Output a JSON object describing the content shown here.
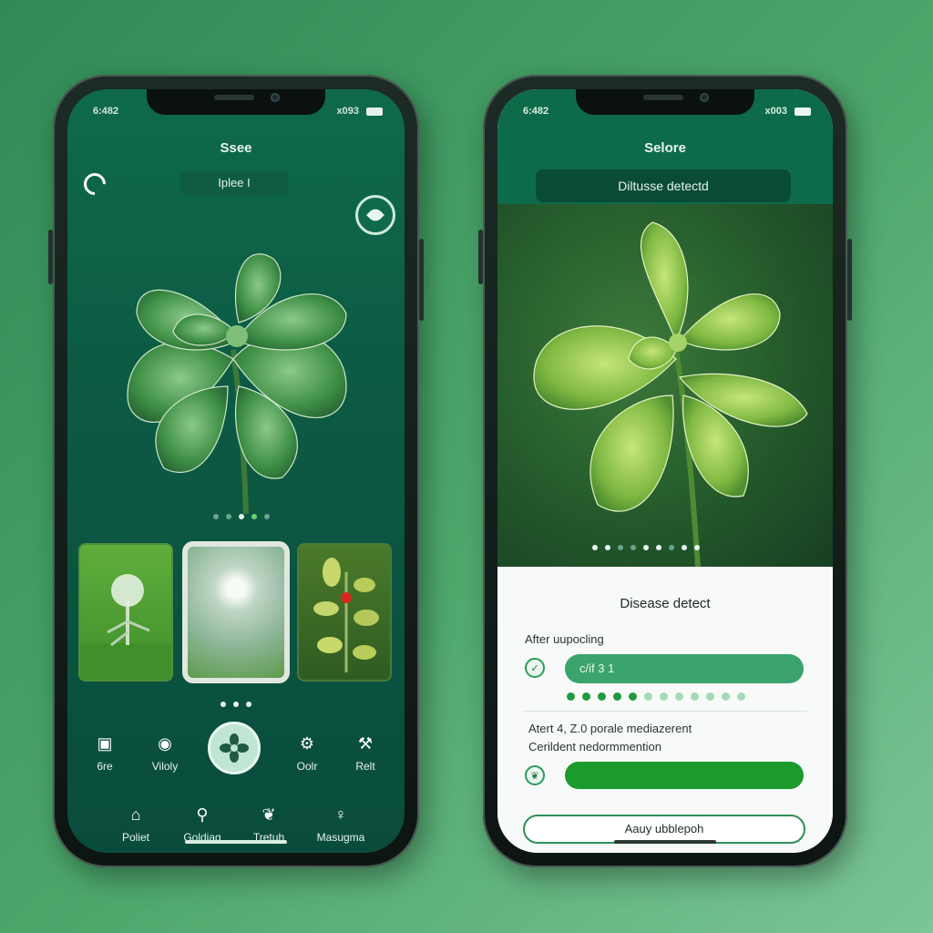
{
  "left_phone": {
    "status_left": "6:482",
    "status_right": "x093",
    "title": "Ssee",
    "search_text": "Iplee I",
    "nav_top": [
      {
        "label": "6re",
        "icon": "camera-icon"
      },
      {
        "label": "Viloly",
        "icon": "location-icon"
      },
      {
        "label": "Oolr",
        "icon": "settings-icon"
      },
      {
        "label": "Relt",
        "icon": "tools-icon"
      }
    ],
    "nav_bottom": [
      {
        "label": "Poliet",
        "icon": "home-icon"
      },
      {
        "label": "Goldiag",
        "icon": "search-icon"
      },
      {
        "label": "Tretuh",
        "icon": "leaf-icon"
      },
      {
        "label": "Masugma",
        "icon": "profile-icon"
      }
    ]
  },
  "right_phone": {
    "status_left": "6:482",
    "status_right": "x003",
    "title": "Selore",
    "banner": "Diltusse detectd",
    "card_title": "Disease detect",
    "label_after": "After uupocling",
    "bar_a_text": "c/if 3 1",
    "line1": "Atert 4, Z.0 porale mediazerent",
    "line2": "Cerildent nedormmention",
    "bar_b_fill": 1.0,
    "button_label": "Aauy ubblepoh"
  },
  "colors": {
    "primary": "#0d6b4a",
    "accent": "#1b9a2e",
    "background": "#4ea86c"
  }
}
